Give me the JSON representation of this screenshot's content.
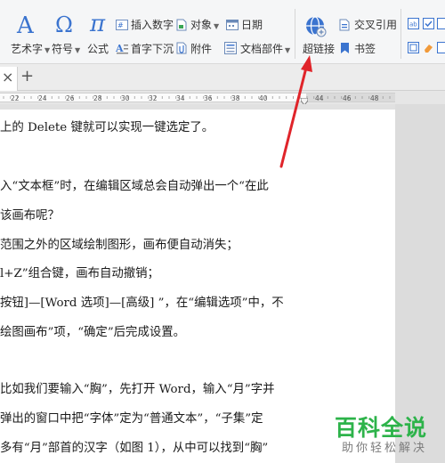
{
  "ribbon": {
    "art_text": "艺术字",
    "symbol": "符号",
    "formula": "公式",
    "insert_number": "插入数字",
    "object": "对象",
    "date": "日期",
    "drop_cap": "首字下沉",
    "attachment": "附件",
    "doc_parts": "文档部件",
    "hyperlink": "超链接",
    "cross_reference": "交叉引用",
    "bookmark": "书签"
  },
  "tabs": {
    "close_glyph": "×",
    "new_tab_glyph": "+"
  },
  "ruler": {
    "ticks": [
      "22",
      "24",
      "26",
      "28",
      "30",
      "32",
      "34",
      "36",
      "38",
      "40",
      "44",
      "46",
      "48"
    ]
  },
  "document": {
    "lines": [
      "上的 Delete 键就可以实现一键选定了。",
      "入“文本框”时，在编辑区域总会自动弹出一个“在此",
      "该画布呢？",
      "范围之外的区域绘制图形，画布便自动消失；",
      "l+Z”组合键，画布自动撤销；",
      "按钮]—[Word 选项]—[高级] ”，在“编辑选项”中，不",
      "绘图画布”项，“确定”后完成设置。",
      "比如我们要输入“胸”，先打开 Word，输入“月”字并",
      "弹出的窗口中把“字体”定为“普通文本”，“子集”定",
      "多有“月”部首的汉字（如图 1），从中可以找到“胸”"
    ]
  },
  "watermark": {
    "title": "百科全说",
    "subtitle": "助你轻松解决"
  },
  "colors": {
    "accent_blue": "#3b74cf",
    "arrow_red": "#e0242a",
    "watermark_green": "#2db34a"
  }
}
